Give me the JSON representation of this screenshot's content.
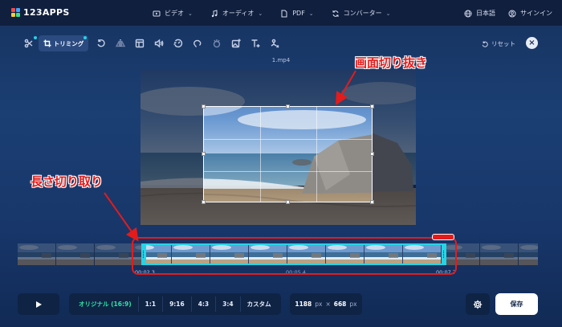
{
  "app": {
    "logo_text": "123APPS"
  },
  "nav": {
    "video": "ビデオ",
    "audio": "オーディオ",
    "pdf": "PDF",
    "converter": "コンバーター",
    "language": "日本語",
    "signin": "サインイン"
  },
  "toolbar": {
    "active_tool_label": "トリミング",
    "reset_label": "リセット",
    "close_label": "×"
  },
  "file": {
    "name": "1.mp4"
  },
  "annotations": {
    "crop_note": "画面切り抜き",
    "trim_note": "長さ切り取り"
  },
  "timeline": {
    "start_time": "00:02.3",
    "mid_time": "00:05.4",
    "end_time": "00:07.7"
  },
  "ratios": [
    "オリジナル (16:9)",
    "1:1",
    "9:16",
    "4:3",
    "3:4",
    "カスタム"
  ],
  "ratio_selected": "オリジナル (16:9)",
  "size": {
    "width": "1188",
    "height": "668",
    "unit": "px",
    "separator": "×"
  },
  "actions": {
    "save_label": "保存"
  },
  "colors": {
    "accent_cyan": "#25d4e6",
    "accent_green": "#2ee3a6",
    "annotation_red": "#e41b1b"
  }
}
